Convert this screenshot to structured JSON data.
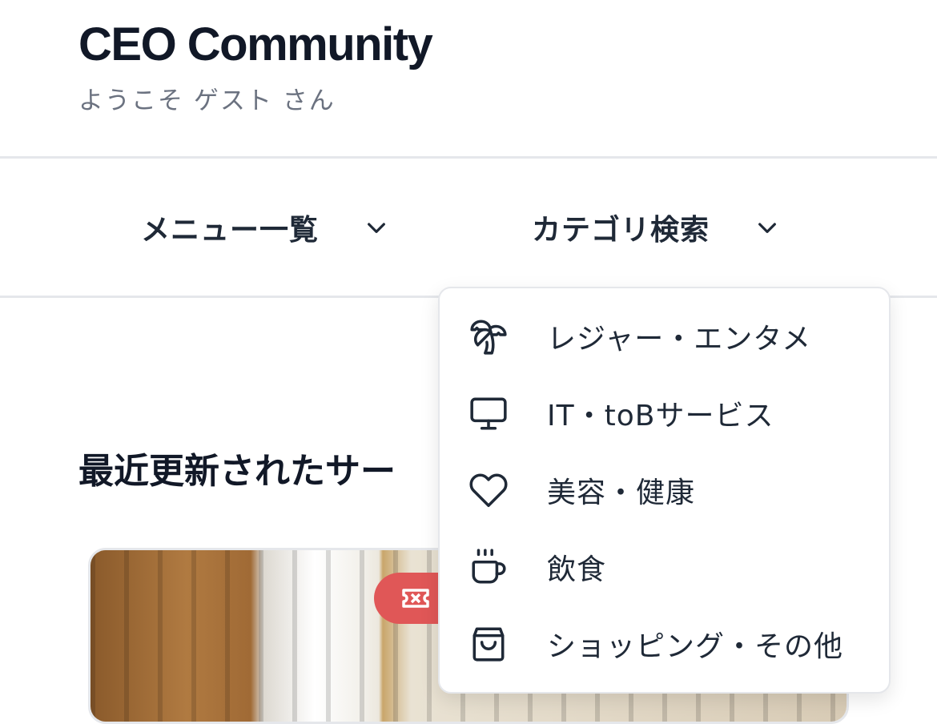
{
  "header": {
    "title": "CEO Community",
    "welcome": "ようこそ ゲスト さん"
  },
  "nav": {
    "menu_label": "メニュー一覧",
    "category_label": "カテゴリ検索"
  },
  "main": {
    "section_title": "最近更新されたサー"
  },
  "category_dropdown": {
    "items": [
      {
        "label": "レジャー・エンタメ",
        "icon": "palm-tree-icon"
      },
      {
        "label": "IT・toBサービス",
        "icon": "monitor-icon"
      },
      {
        "label": "美容・健康",
        "icon": "heart-icon"
      },
      {
        "label": "飲食",
        "icon": "coffee-cup-icon"
      },
      {
        "label": "ショッピング・その他",
        "icon": "shopping-bag-icon"
      }
    ]
  },
  "colors": {
    "text_primary": "#111827",
    "text_muted": "#6b7280",
    "border": "#e5e7eb",
    "badge": "#e05757"
  }
}
